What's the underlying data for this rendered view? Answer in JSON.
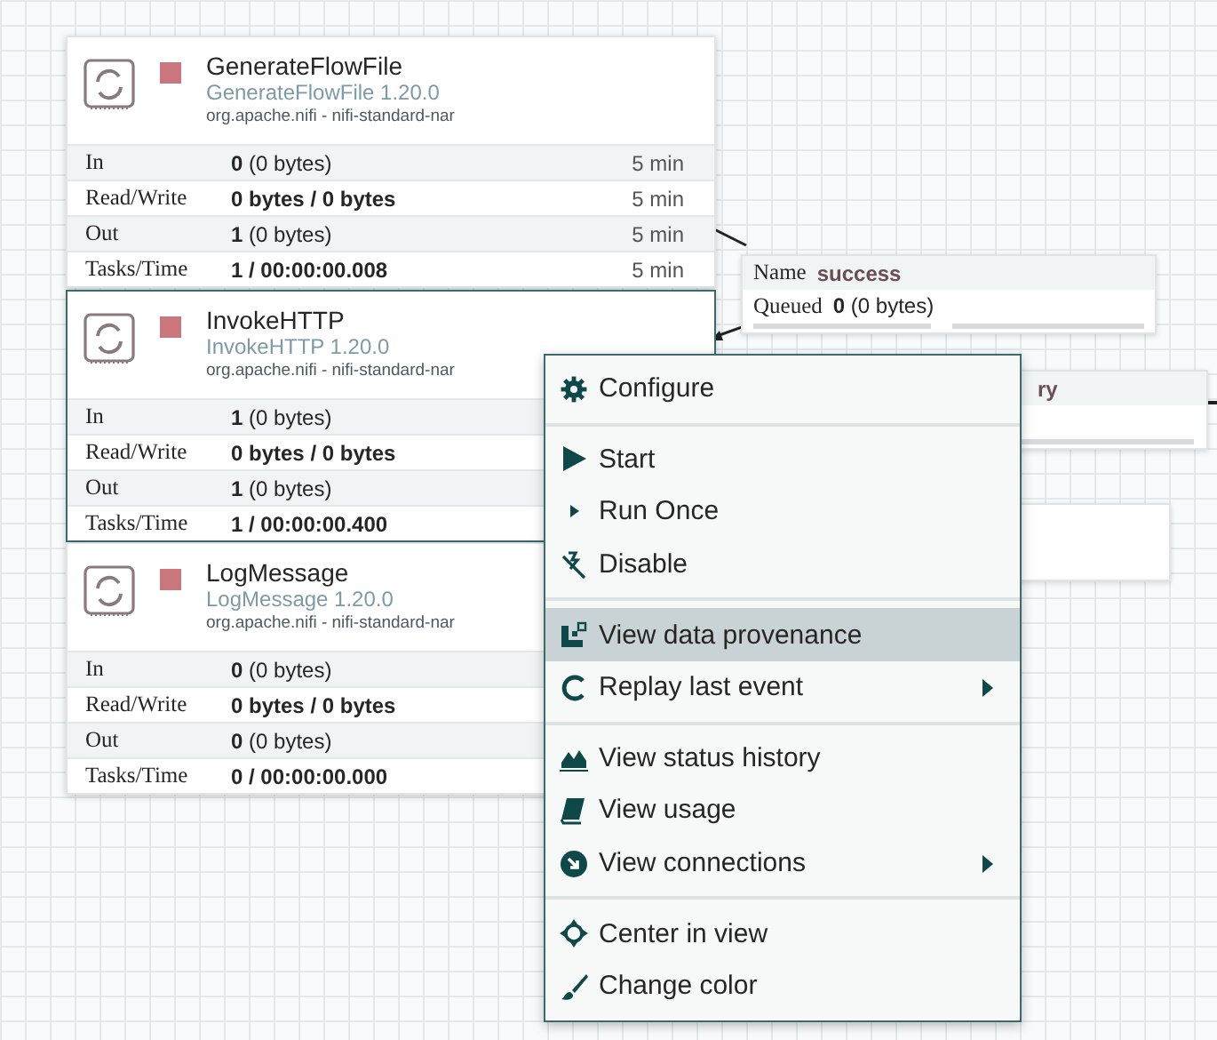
{
  "processors": [
    {
      "name": "GenerateFlowFile",
      "type": "GenerateFlowFile 1.20.0",
      "bundle": "org.apache.nifi - nifi-standard-nar",
      "selected": false,
      "stats": [
        {
          "label": "In",
          "kind": "count",
          "value": "**0** (0 bytes)",
          "time": "5 min"
        },
        {
          "label": "Read/Write",
          "kind": "total",
          "value": "0 bytes / 0 bytes",
          "time": "5 min"
        },
        {
          "label": "Out",
          "kind": "count",
          "value": "**1** (0 bytes)",
          "time": "5 min"
        },
        {
          "label": "Tasks/Time",
          "kind": "total",
          "value": "1 / 00:00:00.008",
          "time": "5 min"
        }
      ]
    },
    {
      "name": "InvokeHTTP",
      "type": "InvokeHTTP 1.20.0",
      "bundle": "org.apache.nifi - nifi-standard-nar",
      "selected": true,
      "stats": [
        {
          "label": "In",
          "kind": "count",
          "value": "**1** (0 bytes)"
        },
        {
          "label": "Read/Write",
          "kind": "total",
          "value": "0 bytes / 0 bytes"
        },
        {
          "label": "Out",
          "kind": "count",
          "value": "**1** (0 bytes)"
        },
        {
          "label": "Tasks/Time",
          "kind": "total",
          "value": "1 / 00:00:00.400"
        }
      ]
    },
    {
      "name": "LogMessage",
      "type": "LogMessage 1.20.0",
      "bundle": "org.apache.nifi - nifi-standard-nar",
      "selected": false,
      "stats": [
        {
          "label": "In",
          "kind": "count",
          "value": "**0** (0 bytes)"
        },
        {
          "label": "Read/Write",
          "kind": "total",
          "value": "0 bytes / 0 bytes"
        },
        {
          "label": "Out",
          "kind": "count",
          "value": "**0** (0 bytes)"
        },
        {
          "label": "Tasks/Time",
          "kind": "total",
          "value": "0 / 00:00:00.000"
        }
      ]
    }
  ],
  "connections": [
    {
      "name_label": "Name",
      "name": "success",
      "queued_label": "Queued",
      "queued": "**0** (0 bytes)"
    },
    {
      "name": "ry"
    }
  ],
  "context_menu": [
    {
      "kind": "item",
      "label": "Configure",
      "highlighted": false,
      "submenu": false
    },
    {
      "kind": "separator"
    },
    {
      "kind": "item",
      "label": "Start",
      "highlighted": false,
      "submenu": false
    },
    {
      "kind": "item",
      "label": "Run Once",
      "highlighted": false,
      "submenu": false
    },
    {
      "kind": "item",
      "label": "Disable",
      "highlighted": false,
      "submenu": false
    },
    {
      "kind": "separator"
    },
    {
      "kind": "item",
      "label": "View data provenance",
      "highlighted": true,
      "submenu": false
    },
    {
      "kind": "item",
      "label": "Replay last event",
      "highlighted": false,
      "submenu": true
    },
    {
      "kind": "separator"
    },
    {
      "kind": "item",
      "label": "View status history",
      "highlighted": false,
      "submenu": false
    },
    {
      "kind": "item",
      "label": "View usage",
      "highlighted": false,
      "submenu": false
    },
    {
      "kind": "item",
      "label": "View connections",
      "highlighted": false,
      "submenu": true
    },
    {
      "kind": "separator"
    },
    {
      "kind": "item",
      "label": "Center in view",
      "highlighted": false,
      "submenu": false
    },
    {
      "kind": "item",
      "label": "Change color",
      "highlighted": false,
      "submenu": false
    }
  ]
}
